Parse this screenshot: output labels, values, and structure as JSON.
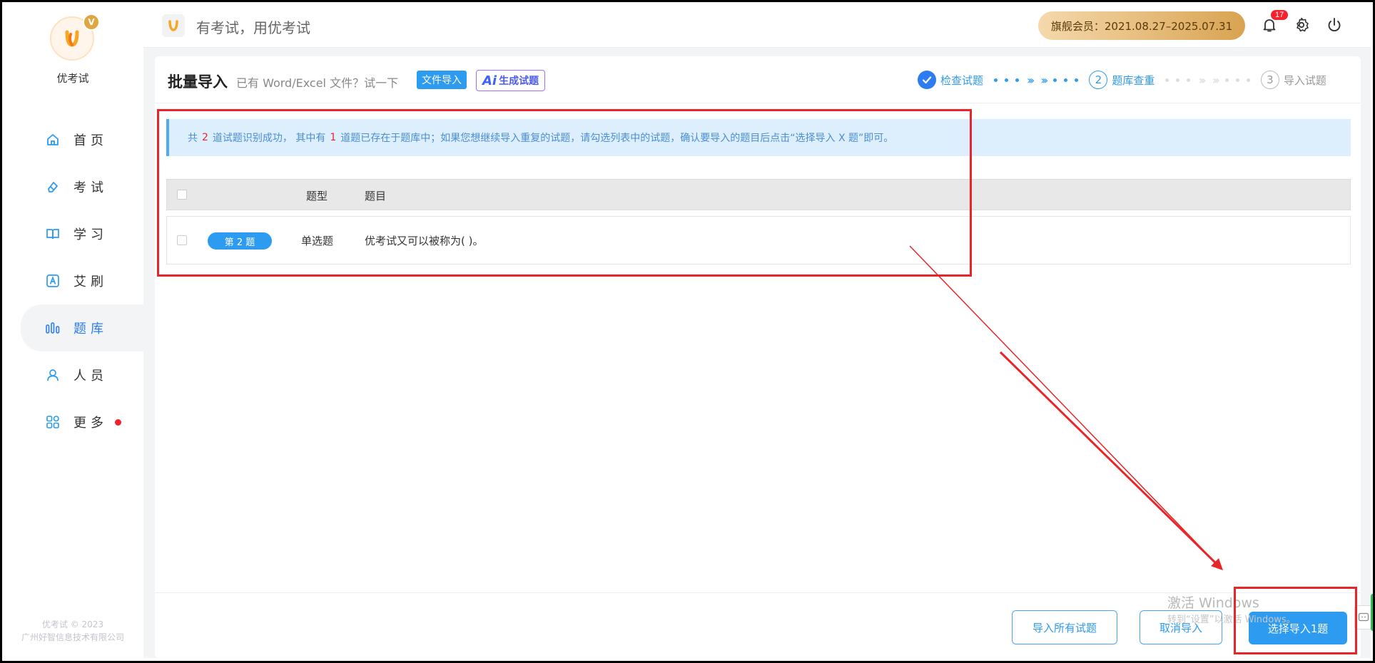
{
  "sidebar": {
    "brand": "优考试",
    "vip_badge": "V",
    "items": [
      {
        "label": "首页",
        "icon": "home-icon"
      },
      {
        "label": "考试",
        "icon": "eraser-icon"
      },
      {
        "label": "学习",
        "icon": "book-icon"
      },
      {
        "label": "艾刷",
        "icon": "a-box-icon"
      },
      {
        "label": "题库",
        "icon": "bars-icon",
        "active": true
      },
      {
        "label": "人员",
        "icon": "user-icon"
      },
      {
        "label": "更多",
        "icon": "apps-icon",
        "dot": true
      }
    ],
    "footer": {
      "line1": "优考试 © 2023",
      "line2": "广州好智信息技术有限公司"
    }
  },
  "header": {
    "title": "有考试，用优考试",
    "membership": "旗舰会员：2021.08.27–2025.07.31",
    "notification_count": "17"
  },
  "card": {
    "title": "批量导入",
    "subtitle": "已有 Word/Excel 文件？试一下",
    "file_import": "文件导入",
    "ai_mark": "Ai",
    "ai_label": "生成试题",
    "steps": [
      {
        "number": "1",
        "label": "检查试题",
        "state": "done"
      },
      {
        "number": "2",
        "label": "题库查重",
        "state": "active"
      },
      {
        "number": "3",
        "label": "导入试题",
        "state": "pending"
      }
    ],
    "info": {
      "p1": "共",
      "total": "2",
      "p2": "道试题识别成功，  其中有",
      "dup": "1",
      "p3": "道题已存在于题库中；如果您想继续导入重复的试题，请勾选列表中的试题，确认要导入的题目后点击“选择导入 X 题”即可。"
    },
    "table": {
      "headers": {
        "type": "题型",
        "question": "题目"
      },
      "rows": [
        {
          "tag": "第 2 题",
          "type": "单选题",
          "question": "优考试又可以被称为( )。"
        }
      ]
    },
    "buttons": {
      "import_all": "导入所有试题",
      "cancel": "取消导入",
      "select_import": "选择导入1题"
    }
  },
  "watermark": {
    "line1": "激活 Windows",
    "line2": "转到“设置”以激活 Windows。"
  },
  "colors": {
    "primary": "#2d9bf0",
    "annotation": "#e8262a",
    "vip": "#d9a351"
  }
}
